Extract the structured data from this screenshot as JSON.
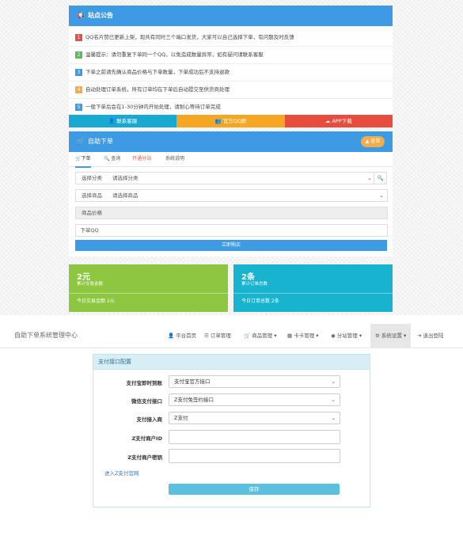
{
  "announcement": {
    "title": "站点公告",
    "items": [
      {
        "num": "1",
        "color": "#d9534f",
        "text": "QQ名片赞已更新上架，现共有同时三个端口发货，大家可以自己选择下单，有问题及时反馈"
      },
      {
        "num": "2",
        "color": "#5cb85c",
        "text": "温馨提示：请勿重复下单同一个QQ，以免造成数量异常，如有疑问请联系客服"
      },
      {
        "num": "3",
        "color": "#3d9be3",
        "text": "下单之前请先确认商品价格与下单数量，下单成功后不支持退款"
      },
      {
        "num": "4",
        "color": "#f0ad4e",
        "text": "自动处理订单系统，所有订单均在下单后自动提交至供货商处理"
      },
      {
        "num": "5",
        "color": "#3d9be3",
        "text": "一般下单后会在1-30分钟内开始处理，请耐心等待订单完成"
      }
    ],
    "buttons": [
      {
        "label": "联系客服",
        "color": "#17a9d2"
      },
      {
        "label": "官方QQ群",
        "color": "#f5a623"
      },
      {
        "label": "APP下载",
        "color": "#e74c3c"
      }
    ]
  },
  "order": {
    "title": "自助下单",
    "query_button": "查单",
    "tabs": [
      "下单",
      "查询",
      "开通分站",
      "系统说明"
    ],
    "category_label": "选择分类",
    "category_value": "请选择分类",
    "product_label": "选择商品",
    "product_value": "请选择商品",
    "price_label": "商品价格",
    "qq_label": "下单QQ",
    "submit": "立即购买"
  },
  "stats": [
    {
      "big": "2元",
      "sub": "累计交易金额",
      "foot": "今日交易金额 2元",
      "color": "#8dc63f"
    },
    {
      "big": "2条",
      "sub": "累计订单总数",
      "foot": "今日订单总数 2条",
      "color": "#17b3cf"
    }
  ],
  "navbar": {
    "brand": "自助下单系统管理中心",
    "items": [
      {
        "icon": "user-icon",
        "glyph": "👤",
        "label": "平台首页"
      },
      {
        "icon": "list-icon",
        "glyph": "☰",
        "label": "订单管理"
      },
      {
        "icon": "cart-icon",
        "glyph": "🛒",
        "label": "商品管理 ▾"
      },
      {
        "icon": "card-icon",
        "glyph": "▦",
        "label": "卡卡管理 ▾"
      },
      {
        "icon": "globe-icon",
        "glyph": "◉",
        "label": "分站管理 ▾"
      },
      {
        "icon": "gear-icon",
        "glyph": "⚙",
        "label": "系统设置 ▾"
      },
      {
        "icon": "logout-icon",
        "glyph": "⇥",
        "label": "退出登陆"
      }
    ]
  },
  "payment": {
    "title": "支付接口配置",
    "fields": [
      {
        "label": "支付宝即时到账",
        "type": "select",
        "value": "支付宝官方接口"
      },
      {
        "label": "微信支付接口",
        "type": "select",
        "value": "Z支付免签约接口"
      },
      {
        "label": "支付接入商",
        "type": "select",
        "value": "Z支付"
      },
      {
        "label": "Z支付商户ID",
        "type": "input",
        "value": ""
      },
      {
        "label": "Z支付商户密钥",
        "type": "input",
        "value": ""
      }
    ],
    "link": "进入Z支付官网",
    "save": "保存"
  }
}
